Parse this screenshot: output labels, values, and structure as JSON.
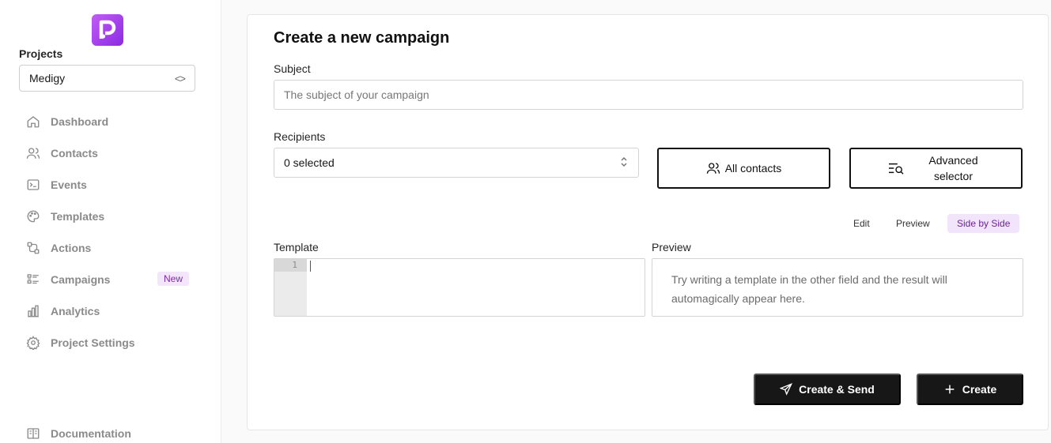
{
  "sidebar": {
    "logo_letter": "P",
    "projects_label": "Projects",
    "project_selected": "Medigy",
    "project_select_icon": "<>",
    "items": [
      {
        "label": "Dashboard",
        "icon": "home-icon"
      },
      {
        "label": "Contacts",
        "icon": "users-icon"
      },
      {
        "label": "Events",
        "icon": "terminal-icon"
      },
      {
        "label": "Templates",
        "icon": "palette-icon"
      },
      {
        "label": "Actions",
        "icon": "workflow-icon"
      },
      {
        "label": "Campaigns",
        "icon": "list-icon",
        "badge": "New"
      },
      {
        "label": "Analytics",
        "icon": "bar-chart-icon"
      },
      {
        "label": "Project Settings",
        "icon": "gear-icon"
      }
    ],
    "documentation_label": "Documentation"
  },
  "main": {
    "title": "Create a new campaign",
    "subject_label": "Subject",
    "subject_placeholder": "The subject of your campaign",
    "recipients_label": "Recipients",
    "recipients_value": "0 selected",
    "all_contacts_label": "All contacts",
    "advanced_selector_label": "Advanced selector",
    "tabs": [
      "Edit",
      "Preview",
      "Side by Side"
    ],
    "active_tab": "Side by Side",
    "template_label": "Template",
    "line_number": "1",
    "preview_label": "Preview",
    "preview_text": "Try writing a template in the other field and the result will automagically appear here.",
    "create_send_label": "Create & Send",
    "create_label": "Create"
  },
  "colors": {
    "accent": "#a03be0",
    "badge_bg": "#f3e6fb",
    "dark_button": "#171717"
  }
}
